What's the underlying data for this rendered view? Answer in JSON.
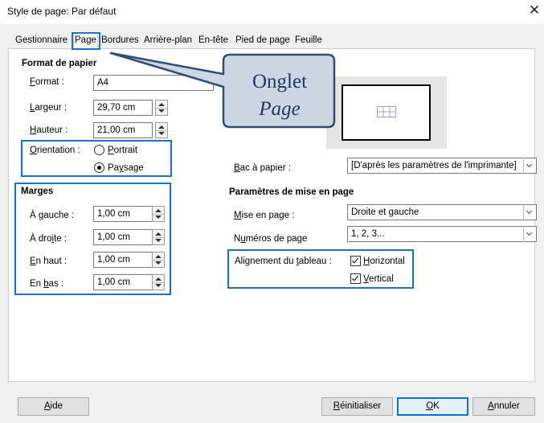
{
  "window": {
    "title": "Style de page: Par défaut",
    "close_symbol": "✕"
  },
  "tabs": [
    {
      "label": "Gestionnaire"
    },
    {
      "label": "Page"
    },
    {
      "label": "Bordures"
    },
    {
      "label": "Arrière-plan"
    },
    {
      "label": "En-tête"
    },
    {
      "label": "Pied de page"
    },
    {
      "label": "Feuille"
    }
  ],
  "paper_format": {
    "section_label": "Format de papier",
    "format_label_u": "F",
    "format_label_rest": "ormat :",
    "format_value": "A4",
    "width_label_u": "L",
    "width_label_rest": "argeur :",
    "width_value": "29,70 cm",
    "height_label_u": "H",
    "height_label_rest": "auteur :",
    "height_value": "21,00 cm",
    "orientation_label_u": "O",
    "orientation_label_rest": "rientation :",
    "portrait_u": "P",
    "portrait_rest": "ortrait",
    "landscape_pre": "Pa",
    "landscape_u": "y",
    "landscape_rest": "sage",
    "selected": "Paysage"
  },
  "margins": {
    "section_label": "Marges",
    "left_pre": "À ",
    "left_u": "g",
    "left_rest": "auche :",
    "left_value": "1,00 cm",
    "right_pre": "À dro",
    "right_u": "i",
    "right_rest": "te :",
    "right_value": "1,00 cm",
    "top_u": "E",
    "top_rest": "n haut :",
    "top_value": "1,00 cm",
    "bottom_pre": "En ",
    "bottom_u": "b",
    "bottom_rest": "as :",
    "bottom_value": "1,00 cm"
  },
  "paper_tray": {
    "label_u": "B",
    "label_rest": "ac à papier :",
    "value": "[D'après les paramètres de l'imprimante]"
  },
  "layout_settings": {
    "section_label": "Paramètres de mise en page",
    "layout_u": "M",
    "layout_rest": "ise en page :",
    "layout_value": "Droite et gauche",
    "page_numbers_pre": "N",
    "page_numbers_u": "u",
    "page_numbers_rest": "méros de page",
    "page_numbers_value": "1, 2, 3...",
    "table_align_pre": "Alignement du ",
    "table_align_u": "t",
    "table_align_rest": "ableau :",
    "horizontal_u": "H",
    "horizontal_rest": "orizontal",
    "horizontal_checked": true,
    "vertical_u": "V",
    "vertical_rest": "ertical",
    "vertical_checked": true
  },
  "callout": {
    "line1": "Onglet",
    "line2": "Page"
  },
  "buttons": {
    "help_u": "A",
    "help_rest": "ide",
    "reset_u": "R",
    "reset_rest": "éinitialiser",
    "ok_u": "O",
    "ok_rest": "K",
    "cancel_u": "A",
    "cancel_rest": "nnuler"
  },
  "colors": {
    "highlight": "#1b72c7",
    "callout_fill": "#cdd6e3",
    "callout_border": "#2f4e74",
    "callout_text": "#1f3864"
  }
}
